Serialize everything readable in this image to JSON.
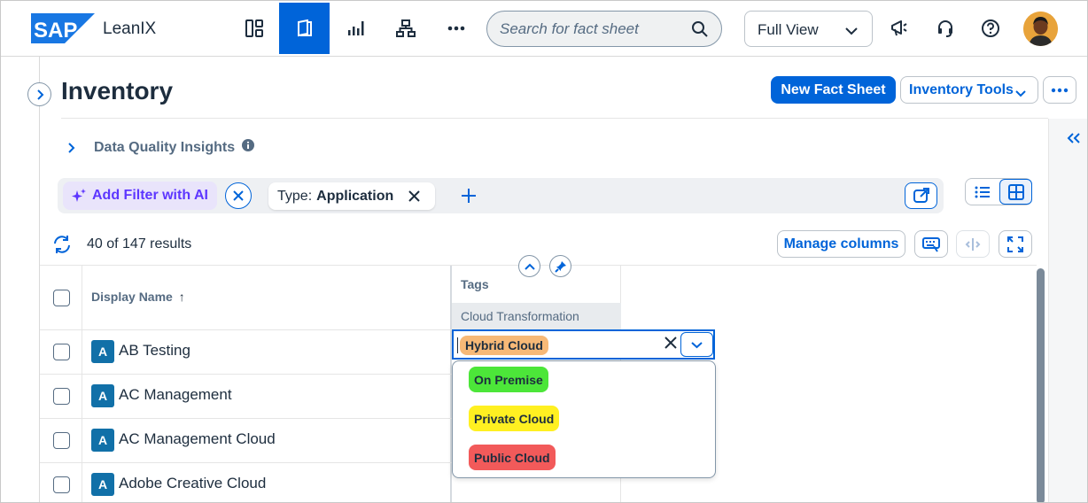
{
  "app": {
    "logo_text": "SAP",
    "name": "LeanIX"
  },
  "nav": {
    "items": [
      {
        "name": "dashboard"
      },
      {
        "name": "inventory",
        "active": true
      },
      {
        "name": "reports"
      },
      {
        "name": "diagrams"
      },
      {
        "name": "more"
      }
    ]
  },
  "search": {
    "placeholder": "Search for fact sheet"
  },
  "view_select": {
    "value": "Full View"
  },
  "page": {
    "title": "Inventory"
  },
  "actions": {
    "new_fact_sheet": "New Fact Sheet",
    "inventory_tools": "Inventory Tools"
  },
  "data_quality": {
    "label": "Data Quality Insights"
  },
  "filters": {
    "ai_label": "Add Filter with AI",
    "chip_key": "Type:",
    "chip_value": "Application"
  },
  "results": {
    "text": "40 of 147 results"
  },
  "toolbar": {
    "manage_columns": "Manage columns"
  },
  "table": {
    "columns": {
      "display_name": "Display Name",
      "sort_indicator": "↑",
      "tags": "Tags",
      "tags_group": "Cloud Transformation"
    },
    "rows": [
      {
        "type": "A",
        "name": "AB Testing"
      },
      {
        "type": "A",
        "name": "AC Management"
      },
      {
        "type": "A",
        "name": "AC Management Cloud"
      },
      {
        "type": "A",
        "name": "Adobe Creative Cloud"
      }
    ]
  },
  "tag_editor": {
    "selected": "Hybrid Cloud",
    "selected_color": "#f7b977",
    "options": [
      {
        "label": "On Premise",
        "color": "#4ce639"
      },
      {
        "label": "Private Cloud",
        "color": "#fff021"
      },
      {
        "label": "Public Cloud",
        "color": "#f25a5a"
      }
    ]
  },
  "colors": {
    "accent": "#0064d9",
    "ai": "#5d36ff",
    "badge": "#1170a8"
  }
}
